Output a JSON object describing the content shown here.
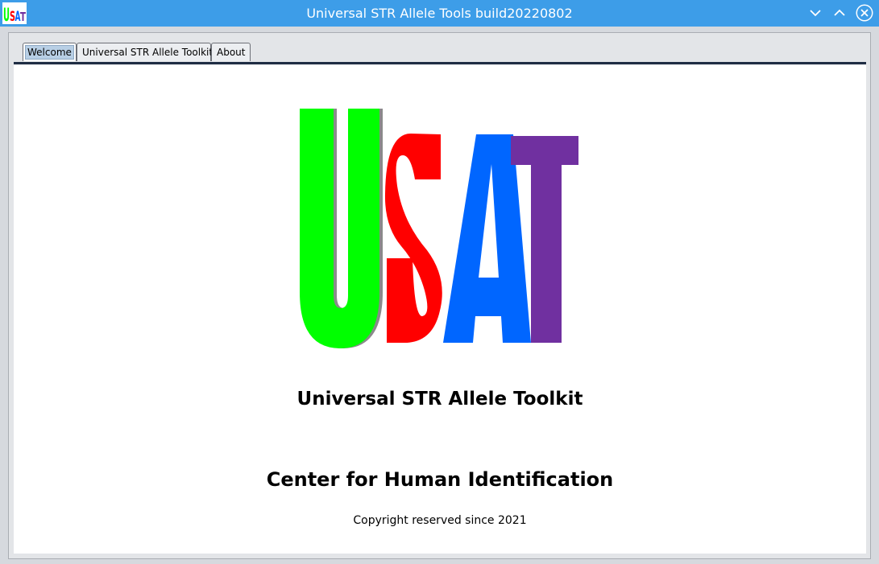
{
  "window": {
    "title": "Universal STR Allele Tools build20220802",
    "icon": "usat-app-icon",
    "controls": [
      "minimize-icon",
      "maximize-icon",
      "close-icon"
    ],
    "accent_color": "#3d9de8"
  },
  "tabs": [
    {
      "label": "Welcome",
      "active": true
    },
    {
      "label": "Universal STR Allele Toolkit",
      "active": false
    },
    {
      "label": "About",
      "active": false
    }
  ],
  "welcome": {
    "logo": {
      "letters": [
        "U",
        "S",
        "A",
        "T"
      ],
      "colors": [
        "#00ff00",
        "#ff0000",
        "#0066ff",
        "#7030a0"
      ]
    },
    "toolkit_title": "Universal STR Allele Toolkit",
    "org_title": "Center for Human Identification",
    "copyright": "Copyright reserved since 2021"
  }
}
